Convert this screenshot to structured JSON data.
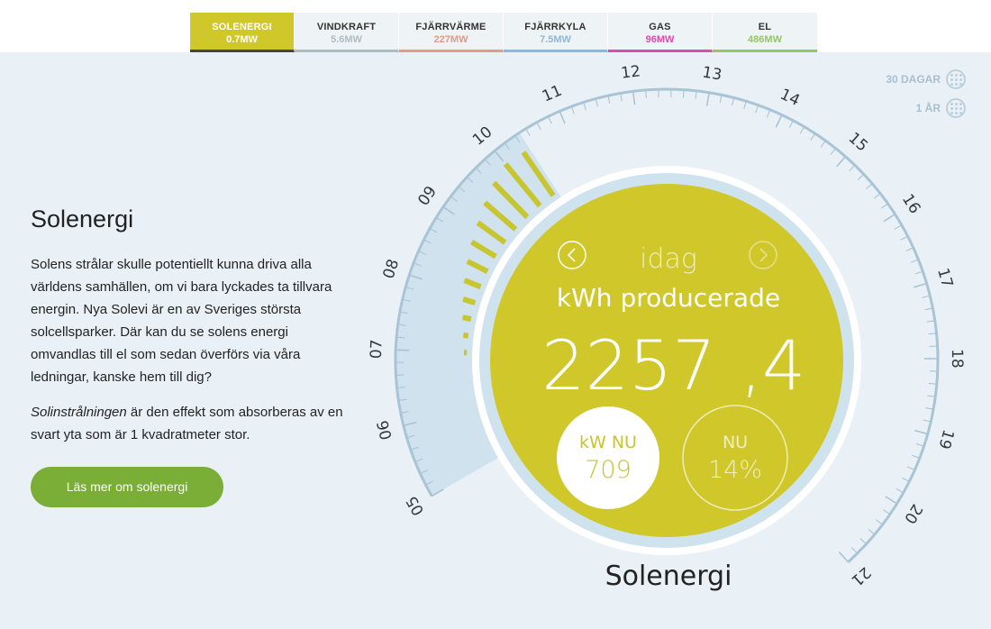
{
  "tabs": [
    {
      "name": "SOLENERGI",
      "value": "0.7MW",
      "color": "#d0c72a",
      "active": true
    },
    {
      "name": "VINDKRAFT",
      "value": "5.6MW",
      "color": "#b0bcc4"
    },
    {
      "name": "FJÄRRVÄRME",
      "value": "227MW",
      "color": "#e39a86"
    },
    {
      "name": "FJÄRRKYLA",
      "value": "7.5MW",
      "color": "#8fb8d6"
    },
    {
      "name": "GAS",
      "value": "96MW",
      "color": "#d94fa7"
    },
    {
      "name": "EL",
      "value": "486MW",
      "color": "#96c466"
    }
  ],
  "range_options": {
    "days30": "30 DAGAR",
    "year": "1 ÅR"
  },
  "info": {
    "title": "Solenergi",
    "paragraph1": "Solens strålar skulle potentiellt kunna driva alla världens samhällen, om vi bara lyckades ta tillvara energin. Nya Solevi är en av Sveriges största solcellsparker. Där kan du se solens energi omvandlas till el som sedan överförs via våra ledningar, kanske hem till dig?",
    "paragraph2_emph": "Solinstrålningen",
    "paragraph2_rest": " är den effekt som absorberas av en svart yta som är 1 kvadratmeter stor.",
    "cta": "Läs mer om solenergi"
  },
  "gauge": {
    "day_label": "idag",
    "unit_label": "kWh producerade",
    "total_int": "2257",
    "total_dec": ",4",
    "kw_label": "kW NU",
    "kw_value": "709",
    "pct_label": "NU",
    "pct_value": "14%",
    "caption": "Solenergi",
    "hour_labels": [
      "05",
      "06",
      "07",
      "08",
      "09",
      "10",
      "11",
      "12",
      "13",
      "14",
      "15",
      "16",
      "17",
      "18",
      "19",
      "20",
      "21"
    ],
    "hour_start": 5,
    "hour_end": 21,
    "current_hour": 10.4,
    "production_hours": [
      7.0,
      7.3,
      7.6,
      7.9,
      8.2,
      8.5,
      8.8,
      9.1,
      9.4,
      9.7,
      10.0,
      10.3
    ],
    "production_values": [
      4,
      7,
      12,
      18,
      25,
      32,
      40,
      48,
      58,
      68,
      77,
      75
    ],
    "production_max": 100,
    "colors": {
      "accent": "#d0c72a",
      "track": "#a9c4d5",
      "bar": "#c7c530",
      "fill": "#cfe2ee"
    }
  }
}
